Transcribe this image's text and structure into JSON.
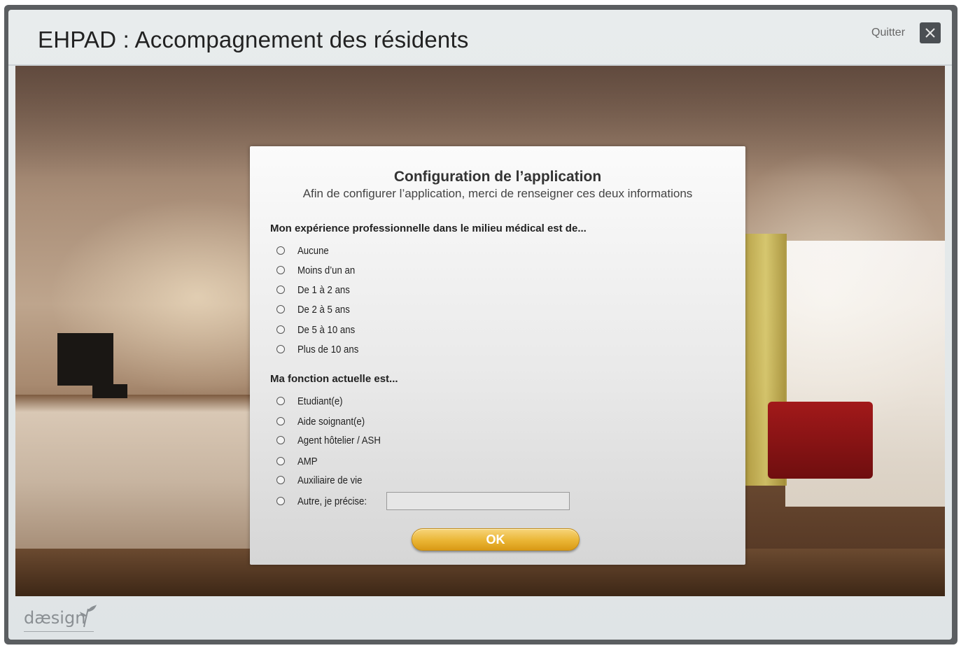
{
  "window": {
    "title": "EHPAD : Accompagnement des résidents",
    "quit_label": "Quitter"
  },
  "dialog": {
    "title": "Configuration de l’application",
    "subtitle": "Afin de configurer l’application, merci de renseigner ces deux informations",
    "question1": {
      "label": "Mon expérience professionnelle dans le milieu médical est de...",
      "options": [
        "Aucune",
        "Moins d’un an",
        "De 1 à 2 ans",
        "De 2 à 5 ans",
        "De 5 à 10 ans",
        "Plus de 10 ans"
      ]
    },
    "question2": {
      "label": "Ma fonction actuelle est...",
      "options": [
        "Etudiant(e)",
        "Aide soignant(e)",
        "Agent hôtelier / ASH",
        "AMP",
        "Auxiliaire de vie",
        "Autre, je précise:"
      ]
    },
    "other_value": "",
    "ok_label": "OK"
  },
  "footer": {
    "logo_text": "dæsign"
  },
  "icons": {
    "quit": "close-icon",
    "logo_leaf": "leaf-icon"
  }
}
